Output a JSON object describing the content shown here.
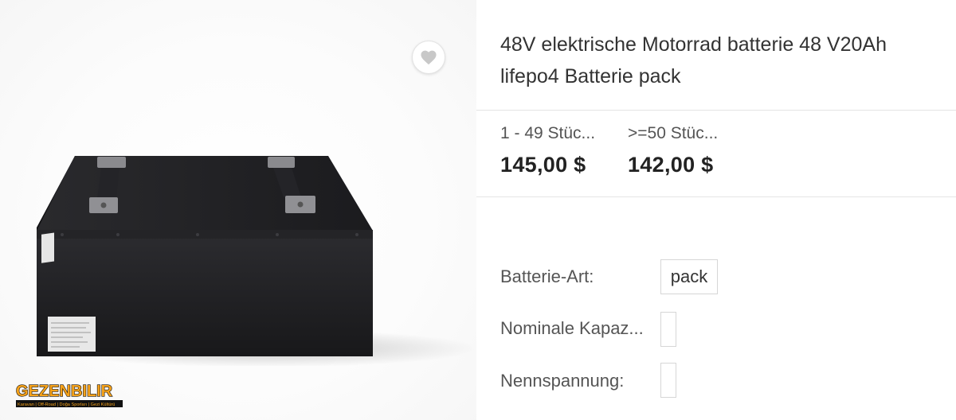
{
  "product": {
    "title": "48V elektrische Motorrad batterie 48 V20Ah lifepo4 Batterie pack",
    "image_alt": "Black battery box with two carrying handles",
    "wishlist_icon": "heart-icon"
  },
  "pricing": [
    {
      "quantity": "1 - 49 Stüc...",
      "price": "145,00 $"
    },
    {
      "quantity": ">=50 Stüc...",
      "price": "142,00 $"
    }
  ],
  "attributes": [
    {
      "label": "Batterie-Art:",
      "selected": "pack"
    },
    {
      "label": "Nominale Kapaz...",
      "selected": ""
    },
    {
      "label": "Nennspannung:",
      "selected": ""
    }
  ],
  "watermark": {
    "brand": "GEZENBILIR",
    "tagline": "Karavan | Off-Road | Doğa Sporları | Gezi Kültürü"
  },
  "colors": {
    "divider": "#e4e4e4",
    "battery_body": "#1d1d1f",
    "watermark_orange": "#f6a21a"
  }
}
